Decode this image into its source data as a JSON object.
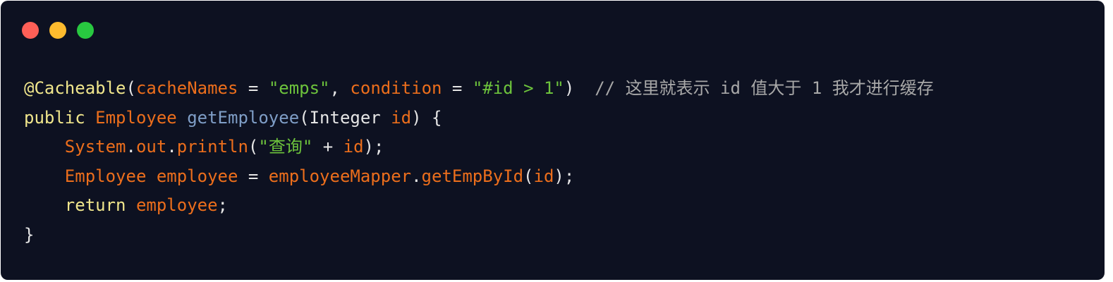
{
  "window": {
    "buttons": [
      {
        "name": "close",
        "color": "#fe5f57"
      },
      {
        "name": "minimize",
        "color": "#febb2e"
      },
      {
        "name": "maximize",
        "color": "#28c840"
      }
    ]
  },
  "colors": {
    "background": "#0d1121",
    "annotation": "#f0e68c",
    "keyword": "#f0e68c",
    "identifier": "#ec6e1c",
    "string": "#6dc33c",
    "method": "#7f9ec7",
    "plain": "#e6e6e6",
    "comment": "#a8a8a8"
  },
  "code": {
    "lines": [
      [
        {
          "t": "@Cacheable",
          "c": "annotation"
        },
        {
          "t": "(",
          "c": "plain"
        },
        {
          "t": "cacheNames",
          "c": "identifier"
        },
        {
          "t": " = ",
          "c": "plain"
        },
        {
          "t": "\"emps\"",
          "c": "string"
        },
        {
          "t": ", ",
          "c": "plain"
        },
        {
          "t": "condition",
          "c": "identifier"
        },
        {
          "t": " = ",
          "c": "plain"
        },
        {
          "t": "\"#id > 1\"",
          "c": "string"
        },
        {
          "t": ")  ",
          "c": "plain"
        },
        {
          "t": "// 这里就表示 id 值大于 1 我才进行缓存",
          "c": "comment"
        }
      ],
      [
        {
          "t": "public",
          "c": "keyword"
        },
        {
          "t": " ",
          "c": "plain"
        },
        {
          "t": "Employee",
          "c": "identifier"
        },
        {
          "t": " ",
          "c": "plain"
        },
        {
          "t": "getEmployee",
          "c": "method"
        },
        {
          "t": "(Integer ",
          "c": "plain"
        },
        {
          "t": "id",
          "c": "identifier"
        },
        {
          "t": ") {",
          "c": "plain"
        }
      ],
      [
        {
          "t": "    ",
          "c": "plain"
        },
        {
          "t": "System",
          "c": "identifier"
        },
        {
          "t": ".",
          "c": "plain"
        },
        {
          "t": "out",
          "c": "identifier"
        },
        {
          "t": ".",
          "c": "plain"
        },
        {
          "t": "println",
          "c": "identifier"
        },
        {
          "t": "(",
          "c": "plain"
        },
        {
          "t": "\"查询\"",
          "c": "string"
        },
        {
          "t": " + ",
          "c": "plain"
        },
        {
          "t": "id",
          "c": "identifier"
        },
        {
          "t": ");",
          "c": "plain"
        }
      ],
      [
        {
          "t": "    ",
          "c": "plain"
        },
        {
          "t": "Employee",
          "c": "identifier"
        },
        {
          "t": " ",
          "c": "plain"
        },
        {
          "t": "employee",
          "c": "identifier"
        },
        {
          "t": " = ",
          "c": "plain"
        },
        {
          "t": "employeeMapper",
          "c": "identifier"
        },
        {
          "t": ".",
          "c": "plain"
        },
        {
          "t": "getEmpById",
          "c": "identifier"
        },
        {
          "t": "(",
          "c": "plain"
        },
        {
          "t": "id",
          "c": "identifier"
        },
        {
          "t": ");",
          "c": "plain"
        }
      ],
      [
        {
          "t": "    ",
          "c": "plain"
        },
        {
          "t": "return",
          "c": "keyword"
        },
        {
          "t": " ",
          "c": "plain"
        },
        {
          "t": "employee",
          "c": "identifier"
        },
        {
          "t": ";",
          "c": "plain"
        }
      ],
      [
        {
          "t": "}",
          "c": "plain"
        }
      ]
    ]
  }
}
